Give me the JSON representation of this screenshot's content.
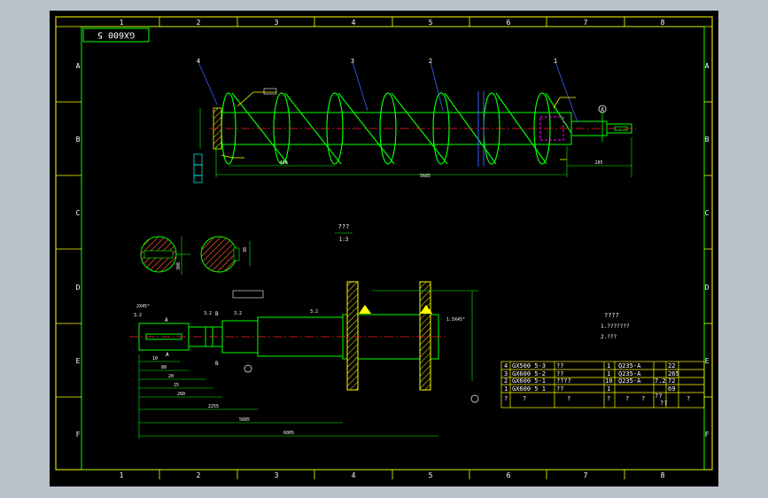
{
  "drawing_id": "GX600 5",
  "col_labels": [
    "1",
    "2",
    "3",
    "4",
    "5",
    "6",
    "7",
    "8"
  ],
  "row_labels": [
    "A",
    "B",
    "C",
    "D",
    "E",
    "F"
  ],
  "balloons": [
    "4",
    "3",
    "2",
    "1"
  ],
  "section_label": "A",
  "view": {
    "title": "???",
    "scale": "1:3"
  },
  "main_view": {
    "pitch": "400",
    "total_length": "5685",
    "end_length": "285"
  },
  "section_dims": {
    "left": "300",
    "right": "38"
  },
  "shaft_dims": [
    "10",
    "80",
    "20",
    "25",
    "260",
    "2255",
    "5685",
    "6005"
  ],
  "shaft_labels": {
    "a": "A",
    "b": "B",
    "chamfer": "2X45°",
    "chamfer2": "1.5X45°",
    "rough1": "3.2",
    "rough2": "3.2",
    "rough3": "3.2",
    "rough4": "3.2"
  },
  "notes": {
    "title": "????",
    "line1": "1.???????",
    "line2": "2.???"
  },
  "bom": [
    [
      "4",
      "GX500 5-3",
      "??",
      "1",
      "Q235-A",
      "",
      "22"
    ],
    [
      "3",
      "GX600 5-2",
      "??",
      "1",
      "Q235-A",
      "",
      "265"
    ],
    [
      "2",
      "GX600 5-1",
      "????",
      "10",
      "Q235-A",
      "7.2",
      "72"
    ],
    [
      "1",
      "GX600 5 1",
      "??",
      "1",
      "",
      "",
      "69"
    ]
  ],
  "bom_header": [
    "?",
    "?",
    "?",
    "?",
    "?",
    "?",
    "??",
    "?"
  ],
  "bom_header_extra": "??",
  "colors": {
    "bg": "#000000",
    "frame": "#ffff00",
    "green": "#00ff00",
    "cyan": "#00ffff",
    "white": "#ffffff",
    "red": "#ff2020",
    "blue": "#4060ff",
    "magenta": "#ff00ff"
  }
}
